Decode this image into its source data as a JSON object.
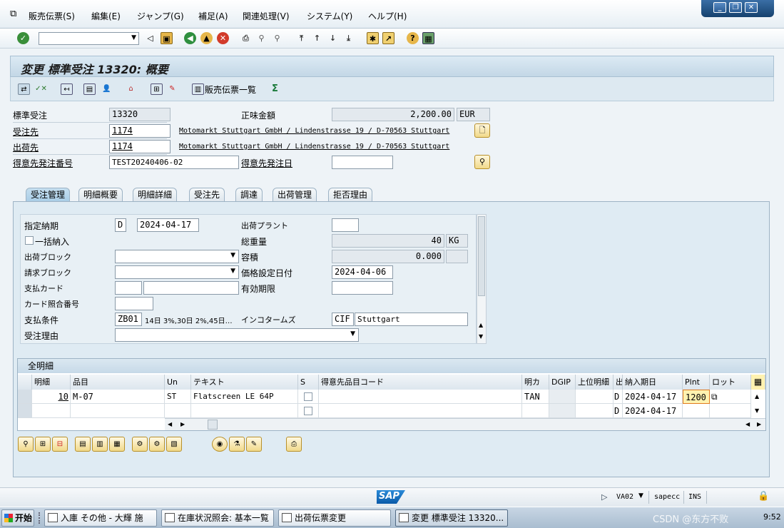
{
  "menu": [
    "販売伝票(S)",
    "編集(E)",
    "ジャンプ(G)",
    "補足(A)",
    "関連処理(V)",
    "システム(Y)",
    "ヘルプ(H)"
  ],
  "window_controls": {
    "minimize": "_",
    "restore": "❐",
    "close": "✕"
  },
  "title": "変更 標準受注 13320: 概要",
  "apptoolbar": {
    "order_list_label": "販売伝票一覧"
  },
  "header": {
    "order_label": "標準受注",
    "order_value": "13320",
    "net_label": "正味金額",
    "net_value": "2,200.00",
    "currency": "EUR",
    "soldto_label": "受注先",
    "soldto_value": "1174",
    "soldto_desc": "Motomarkt Stuttgart GmbH / Lindenstrasse 19 / D-70563 Stuttgart",
    "shipto_label": "出荷先",
    "shipto_value": "1174",
    "shipto_desc": "Motomarkt Stuttgart GmbH / Lindenstrasse 19 / D-70563 Stuttgart",
    "po_label": "得意先発注番号",
    "po_value": "TEST20240406-02",
    "podate_label": "得意先発注日",
    "podate_value": ""
  },
  "tabs": [
    "受注管理",
    "明細概要",
    "明細詳細",
    "受注先",
    "調達",
    "出荷管理",
    "拒否理由"
  ],
  "sales": {
    "reqdate_label": "指定納期",
    "reqdate_type": "D",
    "reqdate_value": "2024-04-17",
    "delplant_label": "出荷プラント",
    "delplant_value": "",
    "complete_label": "一括納入",
    "weight_label": "総重量",
    "weight_value": "40",
    "weight_unit": "KG",
    "delblock_label": "出荷ブロック",
    "volume_label": "容積",
    "volume_value": "0.000",
    "billblock_label": "請求ブロック",
    "pricedate_label": "価格設定日付",
    "pricedate_value": "2024-04-06",
    "card_label": "支払カード",
    "valid_label": "有効期限",
    "cardver_label": "カード照合番号",
    "terms_label": "支払条件",
    "terms_value": "ZB01",
    "terms_desc": "14日 3%,30日 2%,45日…",
    "incoterms_label": "インコタームズ",
    "incoterms_value": "CIF",
    "incoterms_place": "Stuttgart",
    "reason_label": "受注理由"
  },
  "items": {
    "title": "全明細",
    "columns": [
      "明細",
      "品目",
      "Un",
      "テキスト",
      "S",
      "得意先品目コード",
      "明カ",
      "DGIP",
      "上位明細",
      "出",
      "納入期日",
      "Plnt",
      "ロット"
    ],
    "rows": [
      {
        "item": "10",
        "material": "M-07",
        "unit": "ST",
        "text": "Flatscreen LE 64P",
        "cat": "TAN",
        "dt": "D",
        "date": "2024-04-17",
        "plant": "1200"
      },
      {
        "item": "",
        "material": "",
        "unit": "",
        "text": "",
        "cat": "",
        "dt": "D",
        "date": "2024-04-17",
        "plant": ""
      }
    ]
  },
  "status": {
    "tcode": "VA02",
    "server": "sapecc",
    "mode": "INS",
    "sap_logo": "SAP"
  },
  "taskbar": {
    "start": "开始",
    "tasks": [
      "入庫 その他 - 大輝 施",
      "在庫状況照会: 基本一覧",
      "出荷伝票変更",
      "変更 標準受注 13320..."
    ],
    "tray_text": "CSDN @东方不败",
    "time": "9:52"
  }
}
